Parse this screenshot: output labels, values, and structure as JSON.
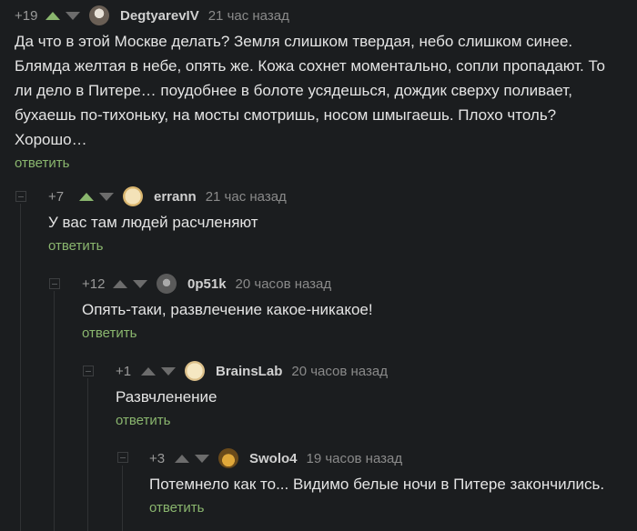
{
  "comments": [
    {
      "rating": "+19",
      "username": "DegtyarevIV",
      "time": "21 час назад",
      "text": "Да что в этой Москве делать? Земля слишком твердая, небо слишком синее. Блямда желтая в небе, опять же. Кожа сохнет моментально, сопли пропадают. То ли дело в Питере… поудобнее в болоте усядешься, дождик сверху поливает, бухаешь по-тихоньку, на мосты смотришь, носом шмыгаешь. Плохо чтоль? Хорошо…",
      "reply": "ответить",
      "upvoted": true
    },
    {
      "rating": "+7",
      "username": "errann",
      "time": "21 час назад",
      "text": "У вас там людей расчленяют",
      "reply": "ответить",
      "upvoted": true
    },
    {
      "rating": "+12",
      "username": "0p51k",
      "time": "20 часов назад",
      "text": "Опять-таки, развлечение какое-никакое!",
      "reply": "ответить",
      "upvoted": false
    },
    {
      "rating": "+1",
      "username": "BrainsLab",
      "time": "20 часов назад",
      "text": "Развчленение",
      "reply": "ответить",
      "upvoted": false
    },
    {
      "rating": "+3",
      "username": "Swolo4",
      "time": "19 часов назад",
      "text": "Потемнело как то... Видимо белые ночи в Питере закончились.",
      "reply": "ответить",
      "upvoted": false
    }
  ],
  "colors": {
    "background": "#1b1d1f",
    "reply_link": "#8ab66e",
    "upvote_active": "#8ab66e"
  },
  "icons": {
    "upvote": "arrow-up-icon",
    "downvote": "arrow-down-icon",
    "collapse": "minus-box-icon"
  }
}
